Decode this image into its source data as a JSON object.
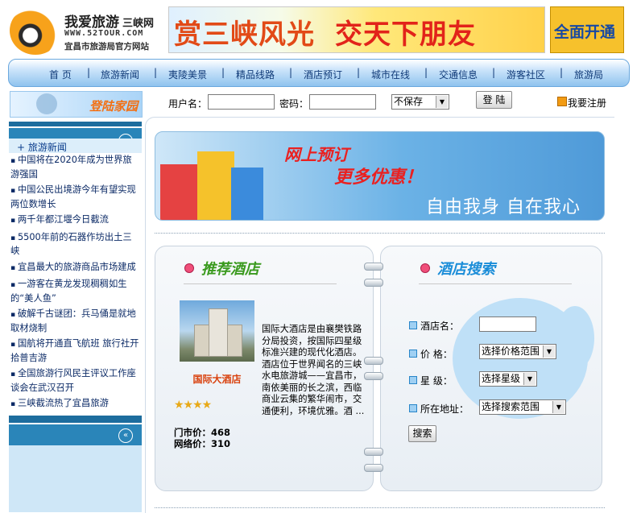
{
  "header": {
    "logo_title": "我爱旅游",
    "logo_subtitle": "三峡网",
    "logo_url": "WWW.52TOUR.COM",
    "logo_caption": "宜昌市旅游局官方网站",
    "banner_text_left": "赏三峡风光",
    "banner_text_right": "交天下朋友",
    "ad_text": "全面开通"
  },
  "nav": {
    "items": [
      "首 页",
      "旅游新闻",
      "夷陵美景",
      "精品线路",
      "酒店预订",
      "城市在线",
      "交通信息",
      "游客社区",
      "旅游局"
    ],
    "separator": "|"
  },
  "login": {
    "art_text": "登陆家园",
    "username_label": "用户名：",
    "password_label": "密码：",
    "save_option": "不保存",
    "login_button": "登 陆",
    "register_link": "我要注册"
  },
  "sidebar": {
    "section_title": "+ 旅游新闻",
    "circle_icon_glyph": "«",
    "news": [
      "中国将在2020年成为世界旅游强国",
      "中国公民出境游今年有望实现两位数增长",
      "两千年都江堰今日截流",
      "5500年前的石器作坊出土三峡",
      "宜昌最大的旅游商品市场建成",
      "一游客在黄龙发现稠稠如生的“美人鱼”",
      "破解千古谜团：兵马俑是就地取材烧制",
      "国航将开通直飞航班 旅行社开拾普吉游",
      "全国旅游行风民主评议工作座谈会在武汉召开",
      "三峡截流热了宜昌旅游"
    ]
  },
  "promo": {
    "line1": "网上预订",
    "line2": "更多优惠！",
    "slogan": "自由我身 自在我心"
  },
  "recommend": {
    "title": "推荐酒店",
    "hotel_name": "国际大酒店",
    "stars": "★★★★",
    "door_price_label": "门市价：",
    "door_price": "468",
    "net_price_label": "网络价：",
    "net_price": "310",
    "description": "国际大酒店是由襄樊铁路分局投资，按国际四星级标准兴建的现代化酒店。酒店位于世界闻名的三峡水电旅游城——宜昌市，南依美丽的长之滨，西临商业云集的繁华闹市，交通便利，环境优雅。酒 ..."
  },
  "search": {
    "title": "酒店搜索",
    "name_label": "酒店名：",
    "price_label": "价  格：",
    "price_select": "选择价格范围",
    "star_label": "星  级：",
    "star_select": "选择星级",
    "address_label": "所在地址：",
    "address_select": "选择搜索范围",
    "search_button": "搜索"
  },
  "colors": {
    "nav_text": "#103a78",
    "sidebar_blue": "#2a85b9",
    "recommend_title": "#3a9a1e",
    "search_title": "#1a8dd8",
    "hotel_name": "#d9420e"
  }
}
